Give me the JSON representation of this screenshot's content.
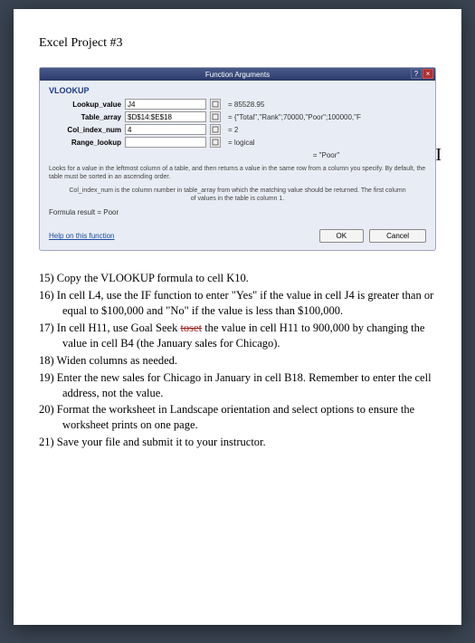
{
  "page_title": "Excel Project #3",
  "dialog": {
    "title": "Function Arguments",
    "help_btn": "?",
    "close_btn": "×",
    "function_name": "VLOOKUP",
    "args": {
      "lookup_value": {
        "label": "Lookup_value",
        "value": "J4",
        "result": "= 85528.95"
      },
      "table_array": {
        "label": "Table_array",
        "value": "$D$14:$E$18",
        "result": "= {\"Total\",\"Rank\";70000,\"Poor\";100000,\"F"
      },
      "col_index": {
        "label": "Col_index_num",
        "value": "4",
        "result": "= 2"
      },
      "range_lookup": {
        "label": "Range_lookup",
        "value": "",
        "result": "= logical"
      }
    },
    "eval_result": "= \"Poor\"",
    "desc_main": "Looks for a value in the leftmost column of a table, and then returns a value in the same row from a column you specify. By default, the table must be sorted in an ascending order.",
    "desc_sub": "Col_index_num  is the column number in table_array from which the matching value should be returned. The first column of values in the table is column 1.",
    "formula_result_label": "Formula result =",
    "formula_result_value": "Poor",
    "help_link": "Help on this function",
    "ok": "OK",
    "cancel": "Cancel"
  },
  "instructions": {
    "i15": "15) Copy the VLOOKUP formula to cell K10.",
    "i16": "16) In cell L4, use the IF function to enter \"Yes\" if the value in cell J4 is greater than or equal to $100,000 and \"No\" if the value is less than $100,000.",
    "i17a": "17) In cell H11, use Goal Seek ",
    "i17strike": "toset",
    "i17b": " the value in cell H11 to 900,000 by changing the value in cell B4 (the January sales for Chicago).",
    "i18": "18) Widen columns as needed.",
    "i19": "19) Enter the new sales for Chicago in January in cell B18. Remember to enter the cell address, not the value.",
    "i20": "20) Format the worksheet in Landscape orientation and select options to ensure the worksheet prints on one page.",
    "i21": "21) Save your file and submit it to your instructor."
  }
}
